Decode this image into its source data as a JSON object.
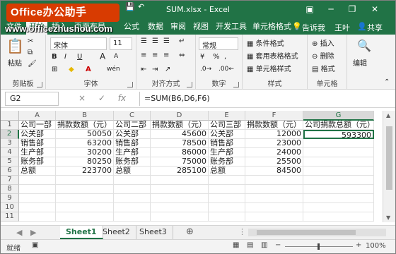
{
  "watermark": {
    "brand": "Office办公助手",
    "url": "www.officezhushou.com"
  },
  "title": "SUM.xlsx - Excel",
  "qat_icons": [
    "save-icon",
    "undo-icon",
    "redo-icon"
  ],
  "window_controls": [
    "ribbon-display-icon",
    "minimize-icon",
    "restore-icon",
    "close-icon"
  ],
  "tabs": [
    "文件",
    "开始",
    "插入",
    "页面布局",
    "公式",
    "数据",
    "审阅",
    "视图",
    "开发工具",
    "单元格格式"
  ],
  "tabs_right": {
    "tellme": "告诉我",
    "user": "王叶",
    "share": "共享"
  },
  "ribbon": {
    "clipboard": {
      "paste": "粘贴",
      "label": "剪贴板"
    },
    "font": {
      "name": "宋体",
      "size": "11",
      "bold": "B",
      "italic": "I",
      "underline": "U",
      "grow": "A",
      "shrink": "A",
      "phonetic": "wén",
      "label": "字体"
    },
    "align": {
      "label": "对齐方式"
    },
    "number": {
      "format": "常规",
      "percent": "%",
      "comma": ",",
      "label": "数字"
    },
    "styles": {
      "conditional": "条件格式",
      "table": "套用表格格式",
      "cell_styles": "单元格样式",
      "label": "样式"
    },
    "cells": {
      "insert": "插入",
      "delete": "删除",
      "format": "格式",
      "label": "单元格"
    },
    "editing": {
      "label": "编辑"
    }
  },
  "formula_bar": {
    "name_box": "G2",
    "formula": "=SUM(B6,D6,F6)",
    "cancel": "×",
    "enter": "✓",
    "fx": "fx"
  },
  "columns": [
    "A",
    "B",
    "C",
    "D",
    "E",
    "F",
    "G"
  ],
  "rows": [
    "1",
    "2",
    "3",
    "4",
    "5",
    "6",
    "7",
    "8",
    "9",
    "10",
    "11"
  ],
  "cells": [
    [
      "公司一部",
      "捐款数额（元）",
      "公司二部",
      "捐款数额（元）",
      "公司三部",
      "捐款数额（元）",
      "公司捐款总额（元）"
    ],
    [
      "公关部",
      "50050",
      "公关部",
      "45600",
      "公关部",
      "12000",
      "593300"
    ],
    [
      "销售部",
      "63200",
      "销售部",
      "78500",
      "销售部",
      "23000",
      ""
    ],
    [
      "生产部",
      "30200",
      "生产部",
      "86000",
      "生产部",
      "24000",
      ""
    ],
    [
      "账务部",
      "80250",
      "账务部",
      "75000",
      "账务部",
      "25500",
      ""
    ],
    [
      "总额",
      "223700",
      "总额",
      "285100",
      "总额",
      "84500",
      ""
    ]
  ],
  "sheets": [
    "Sheet1",
    "Sheet2",
    "Sheet3"
  ],
  "active_sheet": "Sheet1",
  "status": {
    "ready": "就绪",
    "zoom": "100%",
    "zoom_out": "−",
    "zoom_in": "+"
  }
}
